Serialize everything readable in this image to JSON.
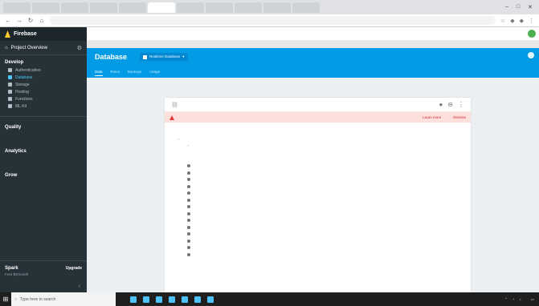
{
  "browser": {
    "tabs": [
      "",
      "",
      "",
      "",
      "",
      "",
      "",
      "",
      "",
      "",
      ""
    ],
    "omnibox_text": ""
  },
  "sidebar": {
    "brand": "Firebase",
    "project": "Project Overview",
    "section": "Develop",
    "develop_items": [
      "Authentication",
      "Database",
      "Storage",
      "Hosting",
      "Functions",
      "ML Kit"
    ],
    "groups": [
      {
        "title": "Quality",
        "subtitle": ""
      },
      {
        "title": "Analytics",
        "subtitle": ""
      },
      {
        "title": "Grow",
        "subtitle": ""
      }
    ],
    "footer_title": "Spark",
    "footer_sub": "Free $0/month",
    "upgrade": "Upgrade"
  },
  "appbar": {
    "title": "Database",
    "db_selector": "Realtime Database",
    "tabs": [
      "Data",
      "Rules",
      "Backups",
      "Usage"
    ]
  },
  "panel": {
    "url": "",
    "warning": "",
    "warning_links": [
      "Learn more",
      "Dismiss"
    ]
  },
  "tree": {
    "root": "",
    "child": "",
    "expanded_key": "",
    "leaves": [
      "",
      ""
    ],
    "items": [
      "",
      "",
      "",
      "",
      "",
      "",
      "",
      "",
      "",
      "",
      "",
      "",
      "",
      ""
    ]
  },
  "taskbar": {
    "search_placeholder": "Type here to search",
    "time": ""
  }
}
